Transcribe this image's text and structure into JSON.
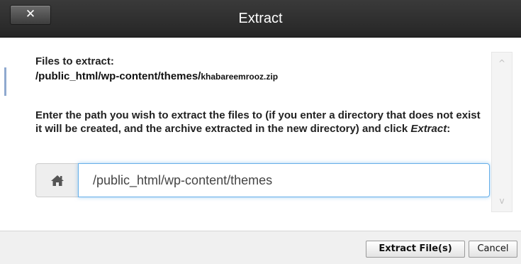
{
  "dialog": {
    "title": "Extract",
    "close_label": "✕"
  },
  "content": {
    "files_label": "Files to extract:",
    "files_path": "/public_html/wp-content/themes/",
    "files_zip": "khabareemrooz.zip",
    "instructions_main": "Enter the path you wish to extract the files to (if you enter a directory that does not exist it will be created, and the archive extracted in the new directory) and click ",
    "instructions_emph": "Extract",
    "instructions_end": ":",
    "home_icon": "home-icon",
    "path_value": "/public_html/wp-content/themes"
  },
  "scrollbar": {
    "up_arrow": "^",
    "down_arrow": "v"
  },
  "footer": {
    "extract_label": "Extract File(s)",
    "cancel_label": "Cancel"
  },
  "colors": {
    "titlebar": "#2f2f2f",
    "input_focus": "#66afe9"
  }
}
